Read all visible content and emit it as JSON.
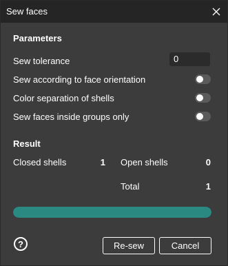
{
  "window": {
    "title": "Sew faces",
    "close_icon": "close-icon"
  },
  "parameters": {
    "heading": "Parameters",
    "sew_tolerance": {
      "label": "Sew tolerance",
      "value": "0"
    },
    "options": [
      {
        "label": "Sew according to face orientation",
        "enabled": false
      },
      {
        "label": "Color separation of shells",
        "enabled": false
      },
      {
        "label": "Sew faces inside groups only",
        "enabled": false
      }
    ]
  },
  "result": {
    "heading": "Result",
    "closed_shells": {
      "label": "Closed shells",
      "value": "1"
    },
    "open_shells": {
      "label": "Open shells",
      "value": "0"
    },
    "total": {
      "label": "Total",
      "value": "1"
    }
  },
  "progress": {
    "percent": 100,
    "color": "#2a8a82"
  },
  "footer": {
    "help_label": "?",
    "resew_label": "Re-sew",
    "cancel_label": "Cancel"
  },
  "colors": {
    "background": "#3c3c3c",
    "titlebar": "#252525",
    "accent": "#2a8a82"
  }
}
